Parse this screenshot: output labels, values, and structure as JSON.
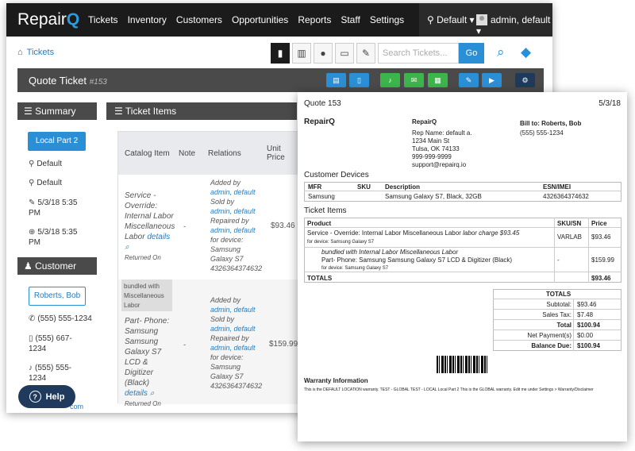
{
  "app": {
    "brand_prefix": "Repair",
    "brand_suffix": "Q"
  },
  "nav": {
    "items": [
      "Tickets",
      "Inventory",
      "Customers",
      "Opportunities",
      "Reports",
      "Staff",
      "Settings"
    ],
    "location": "Default",
    "user": "admin, default"
  },
  "breadcrumb": {
    "label": "Tickets"
  },
  "search": {
    "placeholder": "Search Tickets...",
    "go_label": "Go"
  },
  "header": {
    "title": "Quote Ticket",
    "number": "#153"
  },
  "actions": [
    {
      "icon": "print-icon",
      "color": "#2b8fd6"
    },
    {
      "icon": "document-icon",
      "color": "#2b8fd6"
    },
    {
      "icon": "bell-icon",
      "color": "#3cb54a"
    },
    {
      "icon": "email-icon",
      "color": "#3cb54a"
    },
    {
      "icon": "calendar-icon",
      "color": "#3cb54a"
    },
    {
      "icon": "edit-icon",
      "color": "#2b8fd6"
    },
    {
      "icon": "play-icon",
      "color": "#2b8fd6"
    },
    {
      "icon": "settings-icon",
      "color": "#1f3a5c"
    }
  ],
  "summary": {
    "title": "Summary",
    "status_button": "Local Part 2",
    "location": "Default",
    "tag": "Default",
    "created": "5/3/18 5:35 PM",
    "updated": "5/3/18 5:35 PM"
  },
  "customer": {
    "title": "Customer",
    "name": "Roberts, Bob",
    "phone1": "(555) 555-1234",
    "phone2": "(555) 667-1234",
    "phone3": "(555) 555-1234",
    "email_fragment": "com"
  },
  "help": {
    "label": "Help"
  },
  "ticket_items": {
    "title": "Ticket Items",
    "columns": [
      "Catalog Item",
      "Note",
      "Relations",
      "Unit Price"
    ],
    "rows": [
      {
        "item": "Service - Override: Internal Labor Miscellaneous Labor",
        "details": "details",
        "status": "Returned On",
        "note": "-",
        "added_by": "Added by",
        "added_user": "admin, default",
        "sold_by": "Sold by",
        "sold_user": "admin, default",
        "repaired_by": "Repaired by",
        "repaired_user": "admin, default",
        "for_device": "for device:",
        "device": "Samsung Galaxy S7 4326364374632",
        "price": "$93.46"
      },
      {
        "bundle_tag": "bundled with Miscellaneous Labor",
        "item": "Part- Phone: Samsung Samsung Galaxy S7 LCD & Digitizer (Black)",
        "details": "details",
        "status": "Returned On",
        "note": "-",
        "added_by": "Added by",
        "added_user": "admin, default",
        "sold_by": "Sold by",
        "sold_user": "admin, default",
        "repaired_by": "Repaired by",
        "repaired_user": "admin, default",
        "for_device": "for device:",
        "device": "Samsung Galaxy S7 4326364374632",
        "price": "$159.99"
      }
    ]
  },
  "quote": {
    "title": "Quote 153",
    "date": "5/3/18",
    "company": "RepairQ",
    "rep": "Rep Name: default a.",
    "addr1": "1234 Main St",
    "addr2": "Tulsa, OK 74133",
    "phone": "999-999-9999",
    "email": "support@repairq.io",
    "bill_to": "Bill to: Roberts, Bob",
    "bill_phone": "(555) 555-1234",
    "devices_title": "Customer Devices",
    "device_cols": [
      "MFR",
      "SKU",
      "Description",
      "ESN/IMEI"
    ],
    "device_row": [
      "Samsung",
      "",
      "Samsung Galaxy S7, Black, 32GB",
      "4326364374632"
    ],
    "items_title": "Ticket Items",
    "item_cols": [
      "Product",
      "SKU/SN",
      "Price"
    ],
    "item1": "Service - Override: Internal Labor Miscellaneous Labor",
    "item1_charge": "labor charge $93.45",
    "item1_device": "for device: Samsung Galaxy S7",
    "item1_sku": "VARLAB",
    "item1_price": "$93.46",
    "bundle_note": "bundled with Internal Labor Miscellaneous Labor",
    "item2": "Part- Phone: Samsung Samsung Galaxy S7 LCD & Digitizer (Black)",
    "item2_device": "for device: Samsung Galaxy S7",
    "item2_sku": "-",
    "item2_price": "$159.99",
    "totals_label": "TOTALS",
    "totals_value": "$93.46",
    "summary_title": "TOTALS",
    "subtotal_label": "Subtotal:",
    "subtotal": "$93.46",
    "tax_label": "Sales Tax:",
    "tax": "$7.48",
    "total_label": "Total",
    "total": "$100.94",
    "payment_label": "Net Payment(s)",
    "payment": "$0.00",
    "balance_label": "Balance Due:",
    "balance": "$100.94",
    "warranty_title": "Warranty Information",
    "warranty_text": "This is the DEFAULT LOCATION warranty. TEST - GLOBAL TEST - LOCAL Local Part 2 This is the GLOBAL warranty. Edit me under Settings > Warranty/Disclaimer"
  }
}
